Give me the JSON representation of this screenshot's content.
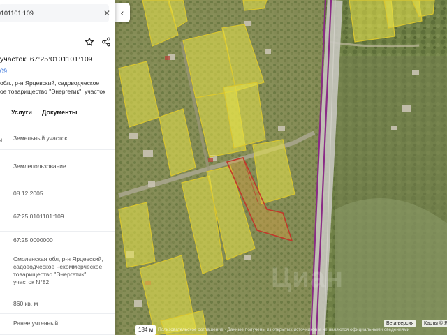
{
  "search": {
    "value": "0101101:109",
    "close_icon": "close-icon"
  },
  "header": {
    "star_icon": "star-outline-icon",
    "share_icon": "share-icon",
    "title": "участок: 67:25:0101101:109",
    "cad_link": "09",
    "address_lines": [
      "обл., р-н Ярцевский, садоводческое",
      "ое товарищество \"Энергетик\", участок"
    ]
  },
  "tabs": [
    {
      "label": "Услуги"
    },
    {
      "label": "Документы"
    }
  ],
  "properties": [
    {
      "label": "ли",
      "value": "Земельный участок"
    },
    {
      "label": "",
      "value": "Землепользование"
    },
    {
      "label": "",
      "value": "08.12.2005"
    },
    {
      "label": "р",
      "value": "67:25:0101101:109"
    },
    {
      "label": "",
      "value": "67:25:0000000"
    },
    {
      "label": "",
      "value_lines": [
        "Смоленская обл, р-н Ярцевский,",
        "садоводческое некоммерческое",
        "товарищество \"Энергетик\",",
        "участок N°82"
      ]
    },
    {
      "label": "",
      "value": "860 кв. м"
    },
    {
      "label": "",
      "value": "Ранее учтенный"
    }
  ],
  "map": {
    "collapse_icon": "chevron-left-icon",
    "scale": "184 м",
    "copyright": "Пользовательское соглашение · Данные получены из открытых источников и не являются официальными сведениями",
    "beta": "Beta-версия",
    "yandex": "Карты © Я",
    "watermark": "Циан",
    "colors": {
      "parcel_fill": "#e8e34a",
      "parcel_stroke": "#d8c630",
      "selected_stroke": "#c0392b",
      "road": "#8a2b86",
      "accent_link": "#2a6ad8"
    }
  }
}
